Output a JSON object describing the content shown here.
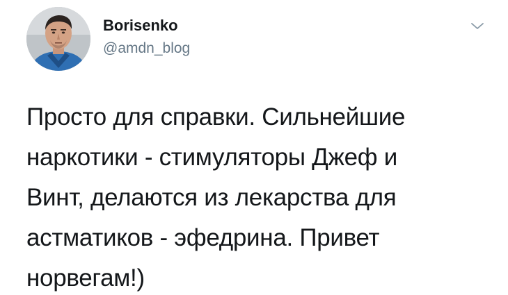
{
  "author": {
    "display_name": "Borisenko",
    "handle": "@amdn_blog",
    "avatar_icon": "user-avatar-photo"
  },
  "menu": {
    "icon": "chevron-down-icon"
  },
  "tweet": {
    "lines": [
      "Просто для справки. Сильнейшие",
      "наркотики - стимуляторы Джеф и",
      "Винт, делаются из лекарства для",
      "астматиков - эфедрина. Привет",
      "норвегам!)"
    ]
  },
  "colors": {
    "text": "#14171a",
    "secondary": "#657786",
    "background": "#ffffff"
  }
}
